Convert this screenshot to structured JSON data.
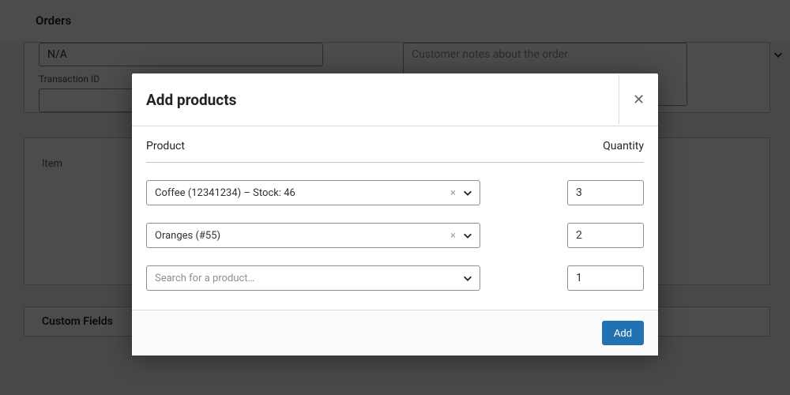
{
  "page": {
    "title": "Orders",
    "payment_select": "N/A",
    "transaction_label": "Transaction ID",
    "notes_placeholder": "Customer notes about the order",
    "items_header": "Item",
    "custom_fields_header": "Custom Fields"
  },
  "modal": {
    "title": "Add products",
    "product_col": "Product",
    "quantity_col": "Quantity",
    "rows": [
      {
        "label": "Coffee (12341234) – Stock: 46",
        "qty": "3",
        "has_value": true
      },
      {
        "label": "Oranges (#55)",
        "qty": "2",
        "has_value": true
      },
      {
        "label": "",
        "qty": "1",
        "has_value": false
      }
    ],
    "search_placeholder": "Search for a product…",
    "add_button": "Add"
  }
}
